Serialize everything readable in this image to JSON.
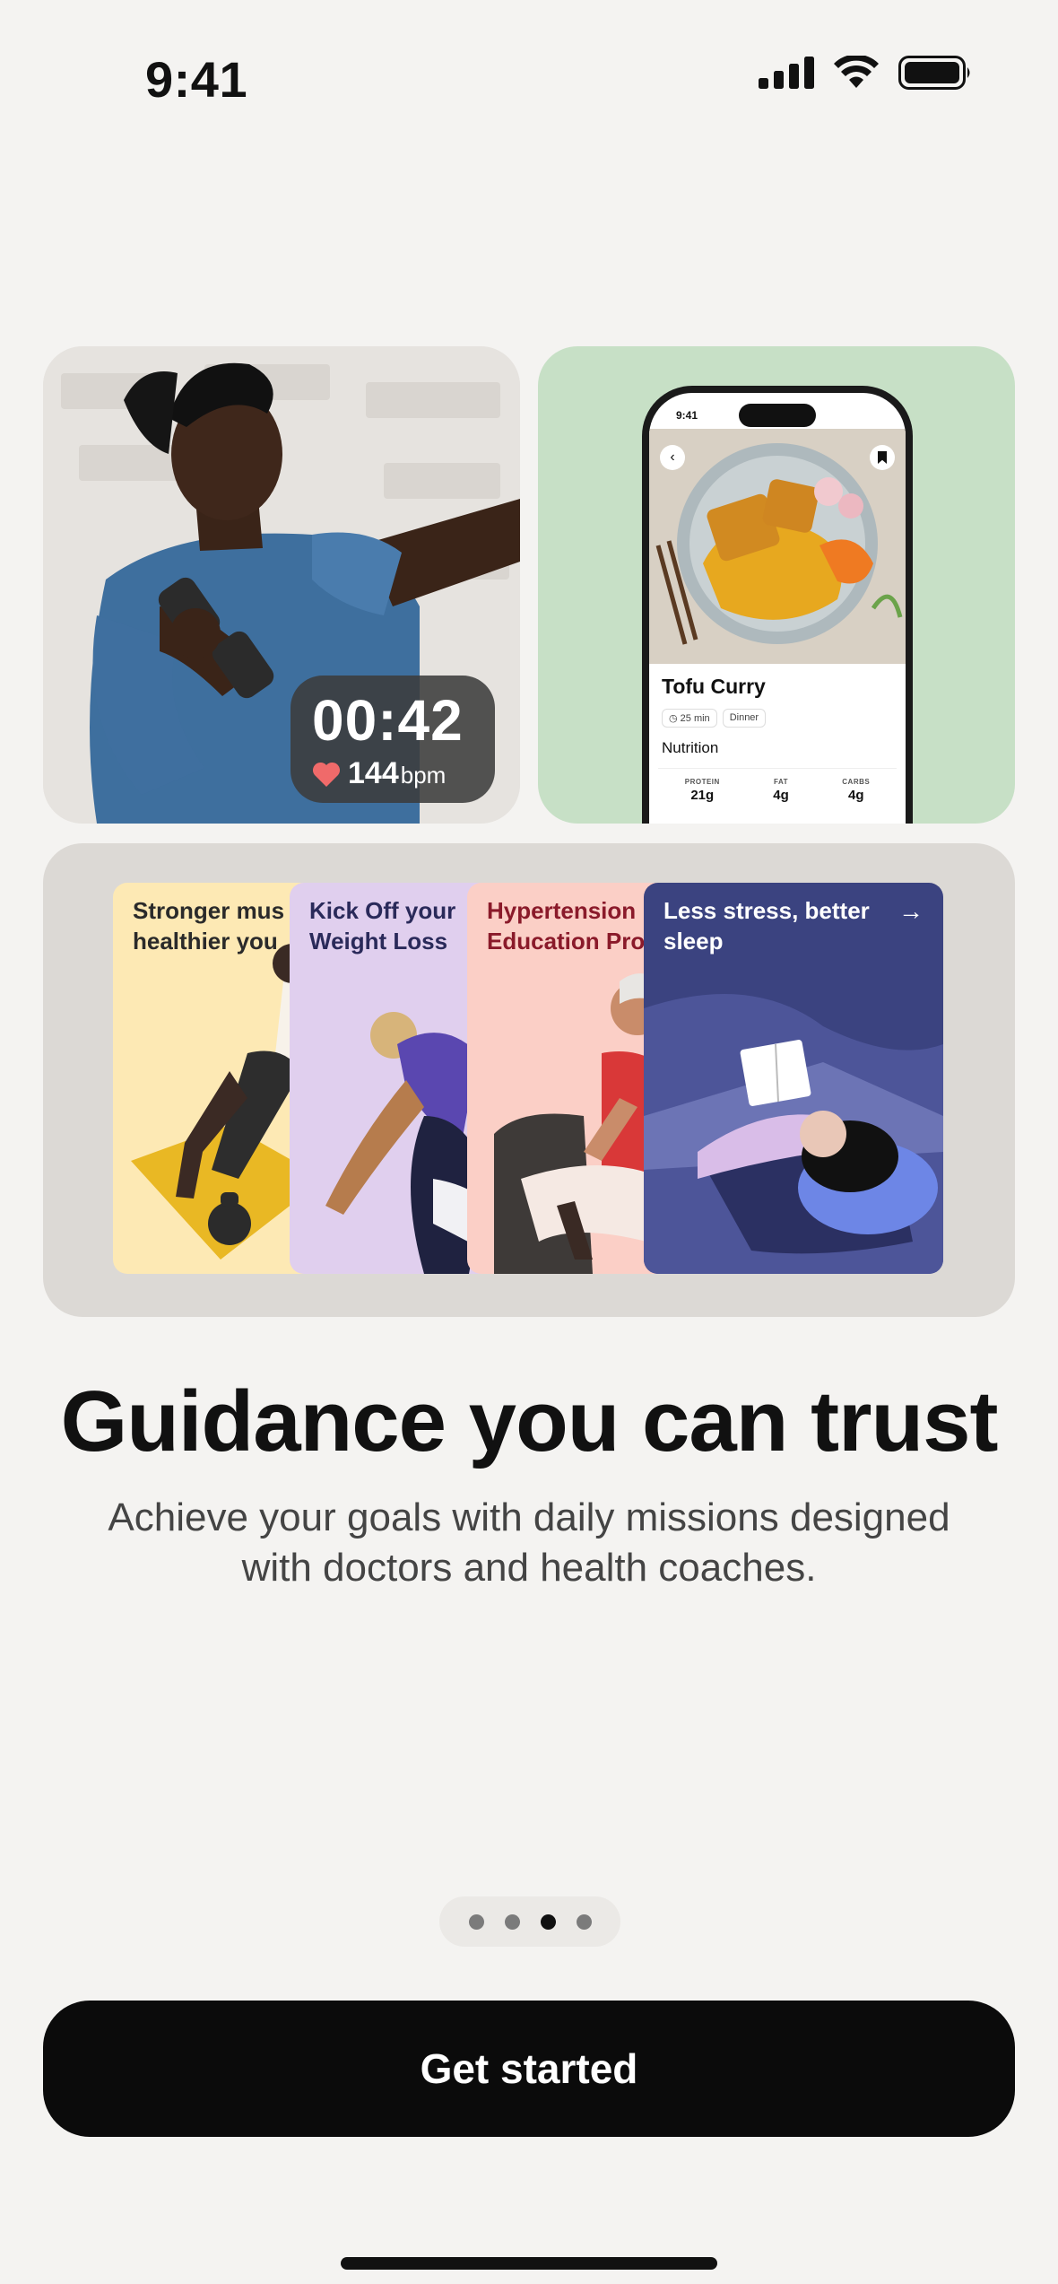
{
  "status_bar": {
    "time": "9:41"
  },
  "tiles": {
    "workout": {
      "timer": "00:42",
      "heart_rate": "144",
      "heart_rate_unit": "bpm"
    },
    "recipe": {
      "phone_time": "9:41",
      "title": "Tofu Curry",
      "duration": "25 min",
      "meal": "Dinner",
      "section": "Nutrition",
      "macros": [
        {
          "label": "PROTEIN",
          "value": "21g"
        },
        {
          "label": "FAT",
          "value": "4g"
        },
        {
          "label": "CARBS",
          "value": "4g"
        }
      ]
    },
    "programs": [
      {
        "line1": "Stronger mus",
        "line2": "healthier you"
      },
      {
        "line1": "Kick Off your",
        "line2": "Weight Loss"
      },
      {
        "line1": "Hypertension",
        "line2": "Education Pro"
      },
      {
        "line1": "Less stress, better",
        "line2": "sleep"
      }
    ]
  },
  "headline": "Guidance you can trust",
  "subheadline_line1": "Achieve your goals with daily missions designed",
  "subheadline_line2": "with doctors and health coaches.",
  "pager": {
    "count": 4,
    "active_index": 2
  },
  "cta_label": "Get started",
  "colors": {
    "background": "#f4f3f1",
    "cta": "#0b0b0b",
    "recipe_tile": "#c7e0c6",
    "programs_tile": "#dcd9d5"
  }
}
